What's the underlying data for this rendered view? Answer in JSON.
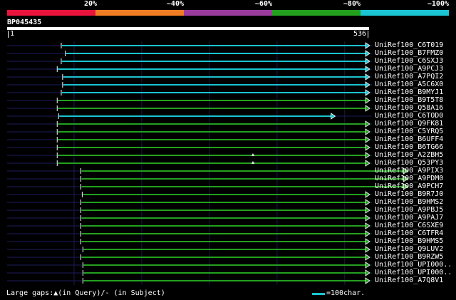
{
  "scale": {
    "labels": [
      "20%",
      "~40%",
      "~60%",
      "~80%",
      "~100%"
    ],
    "colors": [
      "#e8143c",
      "#f07d23",
      "#9a3c9c",
      "#23a01e",
      "#1ac4d2"
    ]
  },
  "query": {
    "id": "BP045435",
    "start": "1",
    "end": "536",
    "length": 536
  },
  "hits": [
    {
      "name": "UniRef100_C6T019",
      "color": "#1ac4d2",
      "start": 81,
      "end": 536,
      "arrow": true,
      "gap": false
    },
    {
      "name": "UniRef100_B7FMZ0",
      "color": "#1ac4d2",
      "start": 87,
      "end": 536,
      "arrow": true,
      "gap": false
    },
    {
      "name": "UniRef100_C6SXJ3",
      "color": "#1ac4d2",
      "start": 81,
      "end": 536,
      "arrow": true,
      "gap": false
    },
    {
      "name": "UniRef100_A9PCJ3",
      "color": "#1ac4d2",
      "start": 75,
      "end": 536,
      "arrow": true,
      "gap": false
    },
    {
      "name": "UniRef100_A7PQI2",
      "color": "#1ac4d2",
      "start": 83,
      "end": 536,
      "arrow": true,
      "gap": false
    },
    {
      "name": "UniRef100_A5C6X0",
      "color": "#1ac4d2",
      "start": 83,
      "end": 536,
      "arrow": true,
      "gap": false
    },
    {
      "name": "UniRef100_B9MYJ1",
      "color": "#1ac4d2",
      "start": 81,
      "end": 536,
      "arrow": true,
      "gap": false
    },
    {
      "name": "UniRef100_B9T5T8",
      "color": "#23a01e",
      "start": 75,
      "end": 536,
      "arrow": true,
      "gap": false
    },
    {
      "name": "UniRef100_Q58A16",
      "color": "#23a01e",
      "start": 75,
      "end": 536,
      "arrow": true,
      "gap": false
    },
    {
      "name": "UniRef100_C6TOD0",
      "color": "#1ac4d2",
      "start": 77,
      "end": 485,
      "arrow": true,
      "gap": false
    },
    {
      "name": "UniRef100_Q9FK81",
      "color": "#23a01e",
      "start": 75,
      "end": 536,
      "arrow": true,
      "gap": false
    },
    {
      "name": "UniRef100_C5YRQ5",
      "color": "#23a01e",
      "start": 75,
      "end": 536,
      "arrow": true,
      "gap": false
    },
    {
      "name": "UniRef100_B6UFF4",
      "color": "#23a01e",
      "start": 75,
      "end": 536,
      "arrow": true,
      "gap": false
    },
    {
      "name": "UniRef100_B6TG66",
      "color": "#23a01e",
      "start": 75,
      "end": 536,
      "arrow": true,
      "gap": false
    },
    {
      "name": "UniRef100_A2ZBH5",
      "color": "#23a01e",
      "start": 75,
      "end": 536,
      "arrow": true,
      "gap": true
    },
    {
      "name": "UniRef100_Q53PY3",
      "color": "#23a01e",
      "start": 75,
      "end": 536,
      "arrow": true,
      "gap": true
    },
    {
      "name": "UniRef100_A9PIX3",
      "color": "#23a01e",
      "start": 110,
      "end": 592,
      "arrow": true,
      "gap": false
    },
    {
      "name": "UniRef100_A9PDM0",
      "color": "#23a01e",
      "start": 110,
      "end": 592,
      "arrow": true,
      "gap": false
    },
    {
      "name": "UniRef100_A9PCH7",
      "color": "#23a01e",
      "start": 110,
      "end": 592,
      "arrow": true,
      "gap": false
    },
    {
      "name": "UniRef100_B9R7J0",
      "color": "#23a01e",
      "start": 112,
      "end": 536,
      "arrow": true,
      "gap": false
    },
    {
      "name": "UniRef100_B9HMS2",
      "color": "#23a01e",
      "start": 110,
      "end": 536,
      "arrow": true,
      "gap": false
    },
    {
      "name": "UniRef100_A9PBJ5",
      "color": "#23a01e",
      "start": 110,
      "end": 536,
      "arrow": true,
      "gap": false
    },
    {
      "name": "UniRef100_A9PAJ7",
      "color": "#23a01e",
      "start": 110,
      "end": 536,
      "arrow": true,
      "gap": false
    },
    {
      "name": "UniRef100_C6SXE9",
      "color": "#23a01e",
      "start": 110,
      "end": 536,
      "arrow": true,
      "gap": false
    },
    {
      "name": "UniRef100_C6TFR4",
      "color": "#23a01e",
      "start": 110,
      "end": 536,
      "arrow": true,
      "gap": false
    },
    {
      "name": "UniRef100_B9HMS5",
      "color": "#23a01e",
      "start": 110,
      "end": 536,
      "arrow": true,
      "gap": false
    },
    {
      "name": "UniRef100_Q9LUV2",
      "color": "#23a01e",
      "start": 113,
      "end": 536,
      "arrow": true,
      "gap": false
    },
    {
      "name": "UniRef100_B9RZW5",
      "color": "#23a01e",
      "start": 110,
      "end": 536,
      "arrow": true,
      "gap": false
    },
    {
      "name": "UniRef100_UPI000..",
      "color": "#23a01e",
      "start": 113,
      "end": 536,
      "arrow": true,
      "gap": false
    },
    {
      "name": "UniRef100_UPI000..",
      "color": "#23a01e",
      "start": 113,
      "end": 536,
      "arrow": true,
      "gap": false
    },
    {
      "name": "UniRef100_A7Q8V1",
      "color": "#23a01e",
      "start": 113,
      "end": 536,
      "arrow": true,
      "gap": false
    }
  ],
  "legend": {
    "text": "Large gaps:▲(in Query)/- (in Subject)",
    "unit": "=100char.",
    "swatch_color": "#1ac4d2"
  }
}
